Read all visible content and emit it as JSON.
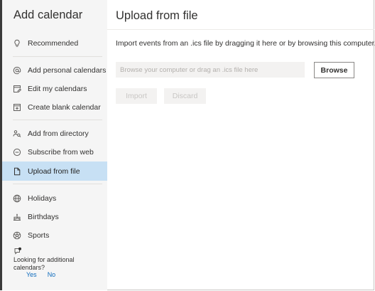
{
  "sidebar": {
    "title": "Add calendar",
    "items": [
      {
        "label": "Recommended",
        "icon": "lightbulb-icon"
      },
      {
        "label": "Add personal calendars",
        "icon": "at-sign-icon"
      },
      {
        "label": "Edit my calendars",
        "icon": "calendar-edit-icon"
      },
      {
        "label": "Create blank calendar",
        "icon": "calendar-add-icon"
      },
      {
        "label": "Add from directory",
        "icon": "people-search-icon"
      },
      {
        "label": "Subscribe from web",
        "icon": "link-icon"
      },
      {
        "label": "Upload from file",
        "icon": "document-icon",
        "active": true
      },
      {
        "label": "Holidays",
        "icon": "globe-icon"
      },
      {
        "label": "Birthdays",
        "icon": "cake-icon"
      },
      {
        "label": "Sports",
        "icon": "sports-ball-icon"
      }
    ],
    "footer": {
      "icon": "feedback-icon",
      "question": "Looking for additional calendars?",
      "yes_label": "Yes",
      "no_label": "No"
    }
  },
  "main": {
    "title": "Upload from file",
    "description": "Import events from an .ics file by dragging it here or by browsing this computer.",
    "file_input": {
      "placeholder": "Browse your computer or drag an .ics file here",
      "value": ""
    },
    "browse_label": "Browse",
    "import_label": "Import",
    "discard_label": "Discard"
  },
  "colors": {
    "accent": "#0f6cbd",
    "active_bg": "#c7e0f4",
    "sidebar_bg": "#f5f5f5",
    "disabled_bg": "#f3f2f1",
    "disabled_text": "#c8c6c4"
  }
}
